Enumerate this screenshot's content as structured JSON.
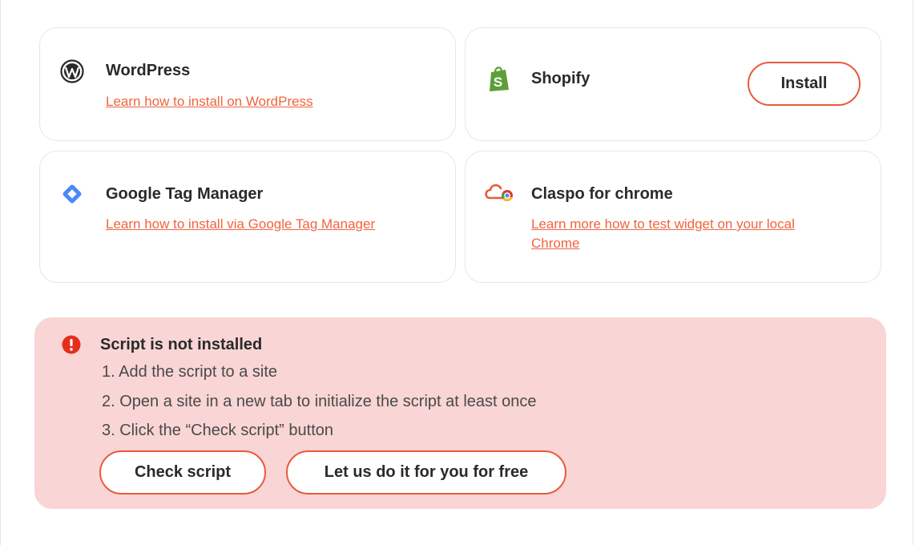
{
  "integrations": [
    {
      "name": "WordPress",
      "link": "Learn how to install on WordPress",
      "icon": "wordpress-icon"
    },
    {
      "name": "Shopify",
      "button": "Install",
      "icon": "shopify-icon"
    },
    {
      "name": "Google Tag Manager",
      "link": "Learn how to install via Google Tag Manager",
      "icon": "google-tag-manager-icon"
    },
    {
      "name": "Claspo for chrome",
      "link_line1": "Learn more how to test widget on your local",
      "link_line2": "Chrome",
      "icon": "claspo-chrome-icon"
    }
  ],
  "alert": {
    "title": "Script is not installed",
    "steps": [
      "1. Add the script to a site",
      "2. Open a site in a new tab to initialize the script at least once",
      "3. Click the “Check script” button"
    ],
    "check_button": "Check script",
    "help_button": "Let us do it for you for free"
  },
  "colors": {
    "accent": "#e85a3a",
    "link": "#f0643f",
    "alert_bg": "#f9d5d5",
    "error": "#e52e1c",
    "shopify": "#5e9e3a"
  }
}
